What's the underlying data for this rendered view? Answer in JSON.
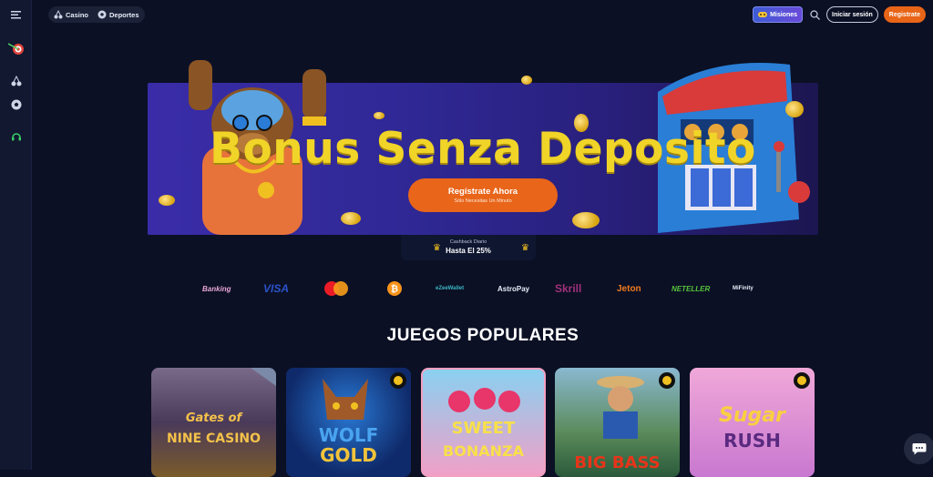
{
  "nav": {
    "menu_icon": "hamburger-icon",
    "casino_label": "Casino",
    "deportes_label": "Deportes"
  },
  "header": {
    "misiones_label": "Misiones",
    "login_label": "Iniciar sesión",
    "register_label": "Registrate"
  },
  "sidebar": {
    "items": [
      {
        "icon": "menu-icon"
      },
      {
        "icon": "cherries-icon"
      },
      {
        "icon": "soccer-ball-icon"
      },
      {
        "icon": "headset-icon"
      }
    ]
  },
  "hero": {
    "title": "Bonus Senza Deposito",
    "cta_label": "Regístrate Ahora",
    "cta_sub": "Sólo Necesitas Un Minuto"
  },
  "cashback": {
    "label": "Cashback Diario",
    "value": "Hasta El 25%"
  },
  "payments": {
    "banking": "Banking",
    "visa": "VISA",
    "ezee": "eZeeWallet",
    "astropay": "AstroPay",
    "skrill": "Skrill",
    "jeton": "Jeton",
    "neteller": "NETELLER",
    "mifinity": "MiFinity"
  },
  "section": {
    "title": "JUEGOS POPULARES"
  },
  "games": [
    {
      "line1": "Gates of",
      "line2": "NINE CASINO"
    },
    {
      "line1": "WOLF",
      "line2": "GOLD"
    },
    {
      "line1": "SWEET",
      "line2": "BONANZA"
    },
    {
      "line1": "",
      "line2": "BIG BASS"
    },
    {
      "line1": "Sugar",
      "line2": "RUSH"
    }
  ],
  "colors": {
    "accent_orange": "#e8651a",
    "hero_yellow": "#f1d428",
    "background": "#0b1024"
  }
}
